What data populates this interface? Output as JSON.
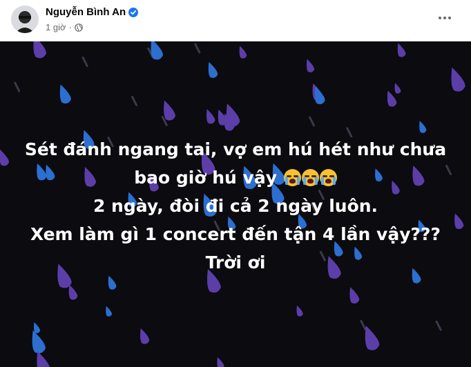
{
  "post": {
    "author": "Nguyễn Bình An",
    "time": "1 giờ",
    "separator": "·",
    "privacy_icon": "globe-icon",
    "verified_icon": "verified-badge-icon",
    "more_icon": "more-options-icon"
  },
  "card": {
    "background_color": "#0b0b10",
    "drop_colors": [
      "#2c6fd0",
      "#5b3ea8",
      "#3a3a4a"
    ],
    "lines": [
      "Sét đánh ngang tai, vợ em hú hét như chưa",
      "bao giờ hú vậy",
      "2 ngày, đòi đi cả 2 ngày luôn.",
      "Xem làm gì 1 concert đến tận 4 lần vậy???",
      "Trời ơi"
    ],
    "emoji": "loudly-crying-face x3"
  }
}
